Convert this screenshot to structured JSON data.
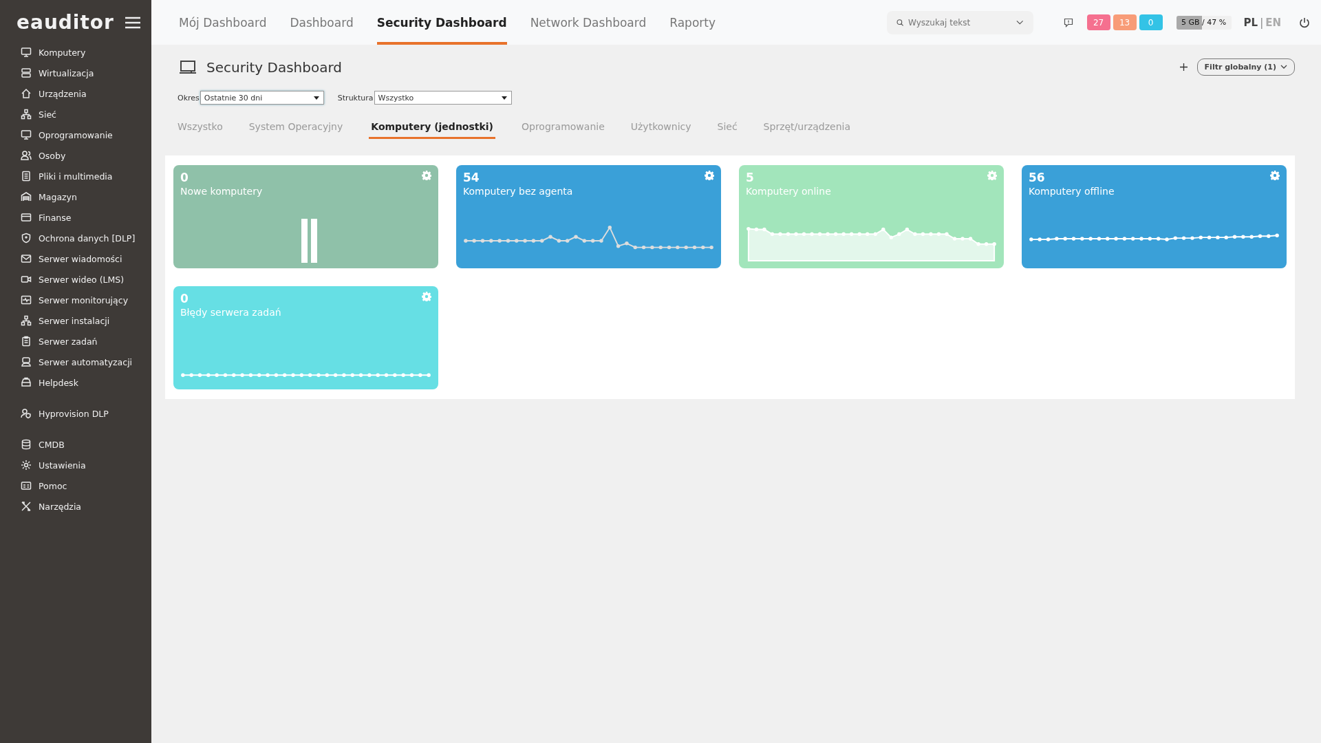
{
  "sidebar": {
    "logo": "eauditor",
    "groups": [
      [
        {
          "label": "Komputery"
        },
        {
          "label": "Wirtualizacja"
        },
        {
          "label": "Urządzenia"
        },
        {
          "label": "Sieć"
        },
        {
          "label": "Oprogramowanie"
        },
        {
          "label": "Osoby"
        },
        {
          "label": "Pliki i multimedia"
        },
        {
          "label": "Magazyn"
        },
        {
          "label": "Finanse"
        },
        {
          "label": "Ochrona danych [DLP]"
        },
        {
          "label": "Serwer wiadomości"
        },
        {
          "label": "Serwer wideo (LMS)"
        },
        {
          "label": "Serwer monitorujący"
        },
        {
          "label": "Serwer instalacji"
        },
        {
          "label": "Serwer zadań"
        },
        {
          "label": "Serwer automatyzacji"
        },
        {
          "label": "Helpdesk"
        }
      ],
      [
        {
          "label": "Hyprovision DLP"
        }
      ],
      [
        {
          "label": "CMDB"
        },
        {
          "label": "Ustawienia"
        },
        {
          "label": "Pomoc"
        },
        {
          "label": "Narzędzia"
        }
      ]
    ]
  },
  "top_tabs": [
    {
      "label": "Mój Dashboard",
      "selected": false
    },
    {
      "label": "Dashboard",
      "selected": false
    },
    {
      "label": "Security Dashboard",
      "selected": true
    },
    {
      "label": "Network Dashboard",
      "selected": false
    },
    {
      "label": "Raporty",
      "selected": false
    }
  ],
  "search": {
    "placeholder": "Wyszukaj tekst"
  },
  "badges": [
    {
      "text": "27",
      "color": "#f5708f"
    },
    {
      "text": "13",
      "color": "#f89c78"
    },
    {
      "text": "0",
      "color": "#33c3e6"
    }
  ],
  "storage": {
    "text": "5 GB / 47 %",
    "level": 0.47
  },
  "language_separator": "|",
  "languages": [
    {
      "label": "PL",
      "selected": true
    },
    {
      "label": "EN",
      "selected": false
    }
  ],
  "page_title": "Security Dashboard",
  "global_filter": {
    "label": "Filtr globalny (1)"
  },
  "filters": [
    {
      "label": "Okres",
      "value": "Ostatnie 30 dni"
    },
    {
      "label": "Struktura",
      "value": "Wszystko"
    }
  ],
  "sub_tabs": [
    {
      "label": "Wszystko",
      "selected": false
    },
    {
      "label": "System Operacyjny",
      "selected": false
    },
    {
      "label": "Komputery (jednostki)",
      "selected": true
    },
    {
      "label": "Oprogramowanie",
      "selected": false
    },
    {
      "label": "Użytkownicy",
      "selected": false
    },
    {
      "label": "Sieć",
      "selected": false
    },
    {
      "label": "Sprzęt/urządzenia",
      "selected": false
    }
  ],
  "cards": [
    {
      "value": "0",
      "title": "Nowe komputery",
      "color": "#8fc1a9",
      "kind": "bars"
    },
    {
      "value": "54",
      "title": "Komputery bez agenta",
      "color": "#3aa0d8",
      "kind": "spiky"
    },
    {
      "value": "5",
      "title": "Komputery online",
      "color": "#a2e5bb",
      "kind": "area"
    },
    {
      "value": "56",
      "title": "Komputery offline",
      "color": "#3aa0d8",
      "kind": "rising"
    },
    {
      "value": "0",
      "title": "Błędy serwera zadań",
      "color": "#66dfe4",
      "kind": "flat"
    }
  ]
}
